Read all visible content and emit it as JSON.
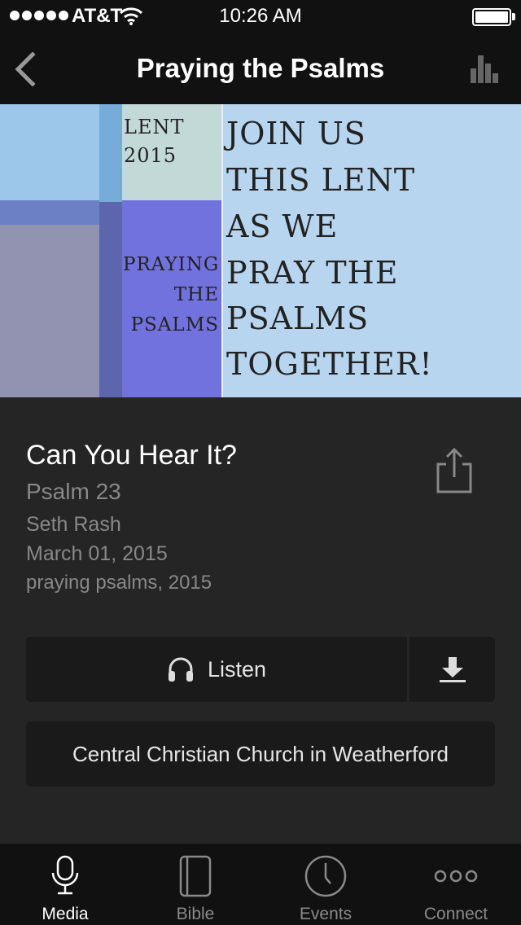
{
  "status_bar": {
    "carrier": "AT&T",
    "time": "10:26 AM"
  },
  "nav": {
    "title": "Praying the Psalms",
    "back_icon": "chevron-left-icon",
    "stats_icon": "bar-chart-icon"
  },
  "banner": {
    "year_label_line1": "LENT",
    "year_label_line2": "2015",
    "series_line1": "PRAYING",
    "series_line2": "THE",
    "series_line3": "PSALMS",
    "message_lines": [
      "JOIN US",
      "THIS LENT",
      "AS WE",
      "PRAY THE",
      "PSALMS",
      "TOGETHER!"
    ]
  },
  "sermon": {
    "title": "Can You Hear It?",
    "scripture": "Psalm 23",
    "speaker": "Seth Rash",
    "date": "March 01, 2015",
    "tags": "praying psalms, 2015"
  },
  "actions": {
    "listen_label": "Listen",
    "church_label": "Central Christian Church in Weatherford"
  },
  "tabs": [
    {
      "label": "Media",
      "icon": "microphone-icon",
      "active": true
    },
    {
      "label": "Bible",
      "icon": "book-icon",
      "active": false
    },
    {
      "label": "Events",
      "icon": "clock-icon",
      "active": false
    },
    {
      "label": "Connect",
      "icon": "more-dots-icon",
      "active": false
    }
  ],
  "colors": {
    "background": "#252525",
    "bar": "#111111",
    "button": "#1a1a1a",
    "banner_light_blue": "#b7d5ee",
    "banner_purple": "#7272de"
  }
}
